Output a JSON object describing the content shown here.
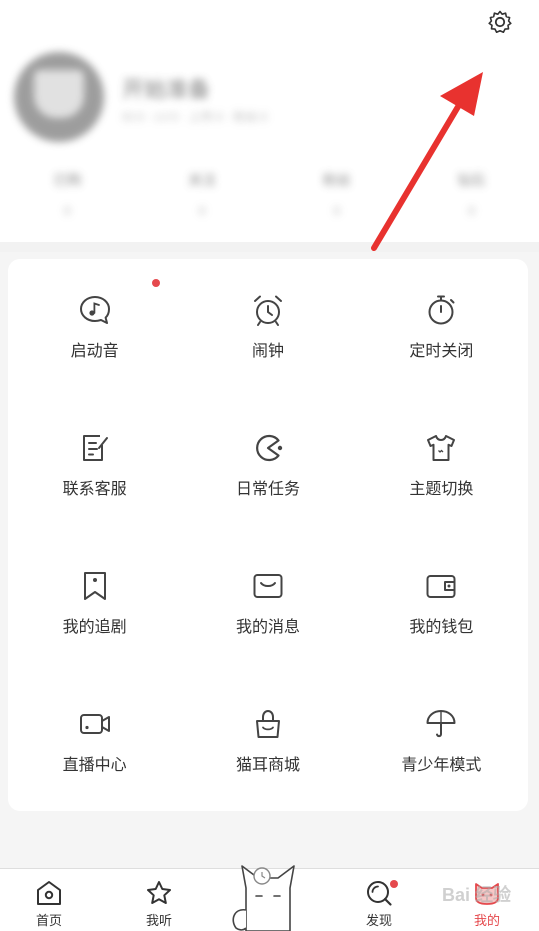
{
  "profile": {
    "name": "开始准备",
    "meta": "ID:0  ·  LV:0  ·  上传:0  ·  粉丝:0",
    "stats": [
      {
        "label": "已购",
        "value": "0"
      },
      {
        "label": "关注",
        "value": "0"
      },
      {
        "label": "粉丝",
        "value": "0"
      },
      {
        "label": "钻石",
        "value": "0"
      }
    ]
  },
  "menu": {
    "items": [
      {
        "label": "启动音",
        "icon": "music-bubble-icon",
        "badge": true
      },
      {
        "label": "闹钟",
        "icon": "alarm-clock-icon"
      },
      {
        "label": "定时关闭",
        "icon": "timer-icon"
      },
      {
        "label": "联系客服",
        "icon": "edit-note-icon"
      },
      {
        "label": "日常任务",
        "icon": "pacman-icon"
      },
      {
        "label": "主题切换",
        "icon": "tshirt-icon"
      },
      {
        "label": "我的追剧",
        "icon": "bookmark-icon"
      },
      {
        "label": "我的消息",
        "icon": "message-icon"
      },
      {
        "label": "我的钱包",
        "icon": "wallet-icon"
      },
      {
        "label": "直播中心",
        "icon": "video-camera-icon"
      },
      {
        "label": "猫耳商城",
        "icon": "shopping-bag-icon"
      },
      {
        "label": "青少年模式",
        "icon": "umbrella-icon"
      }
    ]
  },
  "tabs": [
    {
      "label": "首页",
      "icon": "home-icon"
    },
    {
      "label": "我听",
      "icon": "star-icon"
    },
    {
      "label": "发现",
      "icon": "discover-icon",
      "badge": true
    },
    {
      "label": "我的",
      "icon": "cat-face-icon",
      "active": true
    }
  ],
  "watermark": "Bai 经验",
  "colors": {
    "accent": "#e5494d",
    "icon": "#444444",
    "background": "#f5f5f5"
  }
}
